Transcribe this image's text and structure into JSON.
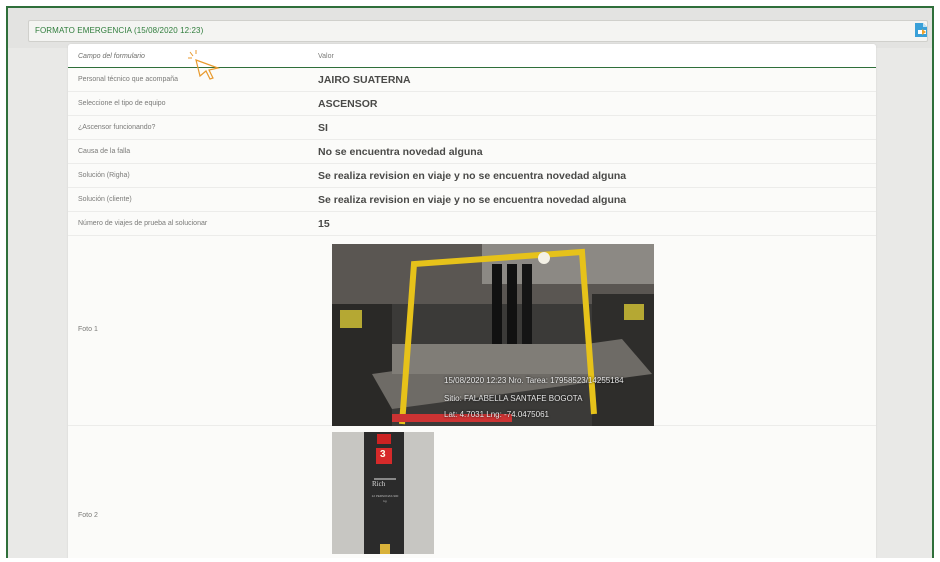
{
  "header": {
    "title": "FORMATO EMERGENCIA (15/08/2020 12:23)",
    "export_icon": "pdf-export-icon"
  },
  "table": {
    "col_label": "Campo del formulario",
    "col_value": "Valor",
    "rows": [
      {
        "label": "Personal técnico que acompaña",
        "value": "JAIRO SUATERNA"
      },
      {
        "label": "Seleccione el tipo de equipo",
        "value": "ASCENSOR"
      },
      {
        "label": "¿Ascensor funcionando?",
        "value": "SI"
      },
      {
        "label": "Causa de la falla",
        "value": "No se encuentra novedad alguna"
      },
      {
        "label": "Solución (Righa)",
        "value": "Se realiza revision en viaje y no se encuentra novedad alguna"
      },
      {
        "label": "Solución (cliente)",
        "value": "Se realiza revision en viaje y no se encuentra novedad alguna"
      },
      {
        "label": "Número de viajes de prueba al solucionar",
        "value": "15"
      }
    ],
    "photo1": {
      "label": "Foto 1",
      "caption_line1": "15/08/2020 12:23 Nro. Tarea: 17958523/14255184",
      "caption_line2": "Sitio: FALABELLA SANTAFE BOGOTA",
      "caption_line3": "Lat: 4.7031 Lng: -74.0475061"
    },
    "photo2": {
      "label": "Foto 2",
      "display_digit": "3",
      "brand": "Rich",
      "plate_text": "12 PERSONAS 900 kg"
    }
  },
  "colors": {
    "accent": "#2f6f3a",
    "title_green": "#2f7d3c",
    "pdf_blue": "#3aa0d8"
  }
}
